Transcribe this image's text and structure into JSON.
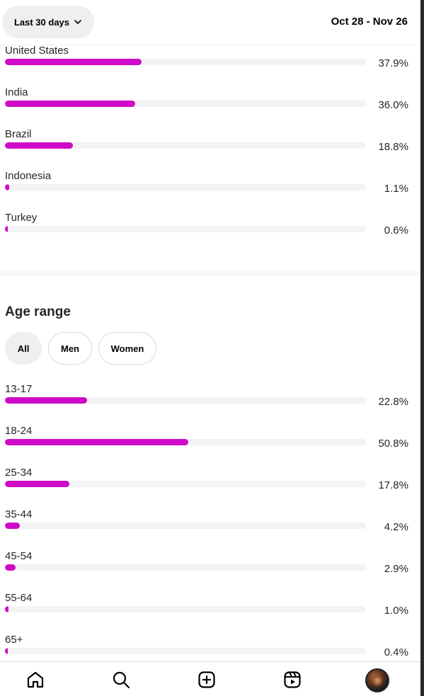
{
  "header": {
    "range_label": "Last 30 days",
    "date_range": "Oct 28 - Nov 26"
  },
  "countries": [
    {
      "label": "United States",
      "percent": "37.9%",
      "value": 37.9
    },
    {
      "label": "India",
      "percent": "36.0%",
      "value": 36.0
    },
    {
      "label": "Brazil",
      "percent": "18.8%",
      "value": 18.8
    },
    {
      "label": "Indonesia",
      "percent": "1.1%",
      "value": 1.1
    },
    {
      "label": "Turkey",
      "percent": "0.6%",
      "value": 0.6
    }
  ],
  "age_section": {
    "title": "Age range",
    "filters": [
      {
        "label": "All",
        "active": true
      },
      {
        "label": "Men",
        "active": false
      },
      {
        "label": "Women",
        "active": false
      }
    ],
    "rows": [
      {
        "label": "13-17",
        "percent": "22.8%",
        "value": 22.8
      },
      {
        "label": "18-24",
        "percent": "50.8%",
        "value": 50.8
      },
      {
        "label": "25-34",
        "percent": "17.8%",
        "value": 17.8
      },
      {
        "label": "35-44",
        "percent": "4.2%",
        "value": 4.2
      },
      {
        "label": "45-54",
        "percent": "2.9%",
        "value": 2.9
      },
      {
        "label": "55-64",
        "percent": "1.0%",
        "value": 1.0
      },
      {
        "label": "65+",
        "percent": "0.4%",
        "value": 0.4
      }
    ]
  },
  "colors": {
    "bar_fill": "#cf0ac8",
    "bar_track": "#f3f2f5"
  },
  "nav": {
    "icons": [
      "home-icon",
      "search-icon",
      "create-icon",
      "reels-icon",
      "profile-avatar"
    ]
  }
}
